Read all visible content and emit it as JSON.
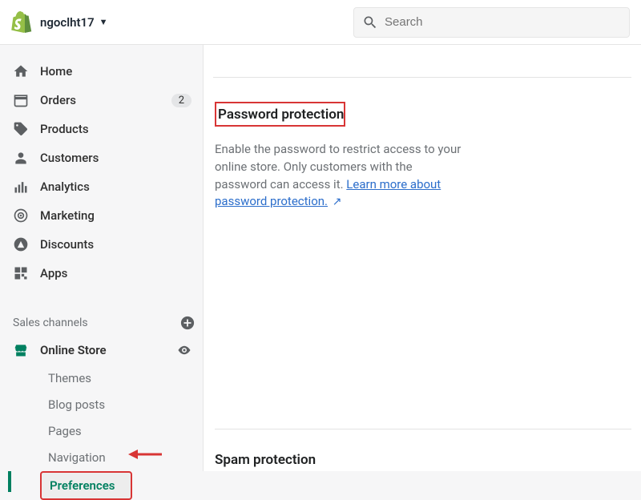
{
  "header": {
    "storeName": "ngoclht17",
    "searchPlaceholder": "Search"
  },
  "sidebar": {
    "items": [
      {
        "label": "Home"
      },
      {
        "label": "Orders",
        "badge": "2"
      },
      {
        "label": "Products"
      },
      {
        "label": "Customers"
      },
      {
        "label": "Analytics"
      },
      {
        "label": "Marketing"
      },
      {
        "label": "Discounts"
      },
      {
        "label": "Apps"
      }
    ],
    "channelsTitle": "Sales channels",
    "onlineStore": "Online Store",
    "subitems": [
      {
        "label": "Themes"
      },
      {
        "label": "Blog posts"
      },
      {
        "label": "Pages"
      },
      {
        "label": "Navigation"
      },
      {
        "label": "Preferences"
      }
    ]
  },
  "main": {
    "pwdTitle": "Password protection",
    "pwdDesc1": "Enable the password to restrict access to your online store. Only customers with the password can access it. ",
    "pwdLink": "Learn more about password protection.",
    "spamTitle": "Spam protection"
  },
  "colors": {
    "brandGreen": "#008060",
    "highlightRed": "#d83535",
    "link": "#2c6ecb"
  }
}
